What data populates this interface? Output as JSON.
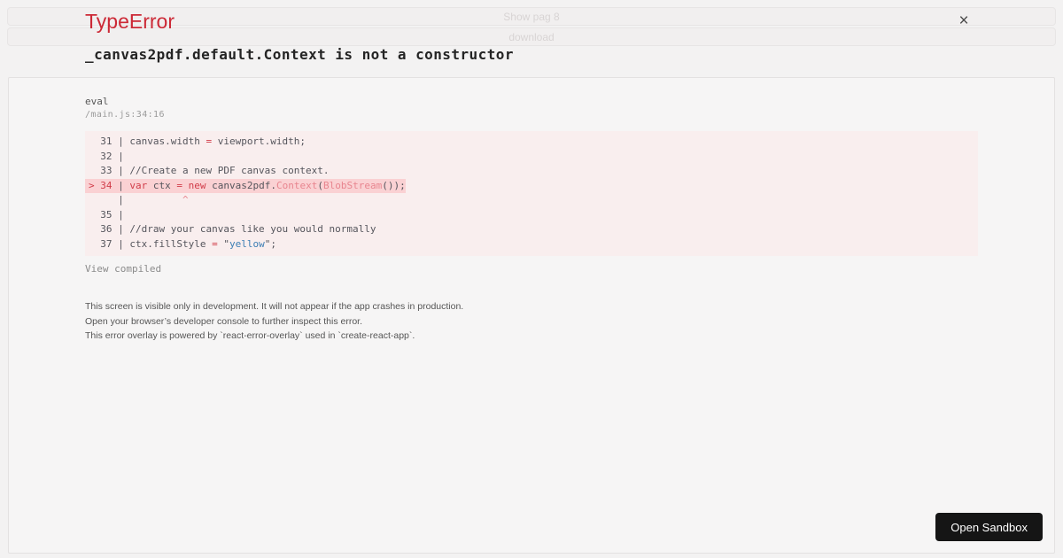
{
  "background_page": {
    "show_page_button": "Show pag 8",
    "download_button": "download"
  },
  "error_overlay": {
    "close_icon": "×",
    "error_type": "TypeError",
    "error_message": "_canvas2pdf.default.Context is not a constructor",
    "stack_frame": {
      "function_name": "eval",
      "source_location": "/main.js:34:16"
    },
    "code_frame": {
      "lines": [
        {
          "highlight": false,
          "tokens": [
            [
              "plain",
              "  31 | canvas.width "
            ],
            [
              "red",
              "="
            ],
            [
              "plain",
              " viewport.width;"
            ]
          ]
        },
        {
          "highlight": false,
          "tokens": [
            [
              "plain",
              "  32 | "
            ]
          ]
        },
        {
          "highlight": false,
          "tokens": [
            [
              "plain",
              "  33 | //Create a new PDF canvas context."
            ]
          ]
        },
        {
          "highlight": true,
          "tokens": [
            [
              "red",
              "> 34 "
            ],
            [
              "plain",
              "| "
            ],
            [
              "red",
              "var"
            ],
            [
              "plain",
              " ctx "
            ],
            [
              "red",
              "="
            ],
            [
              "plain",
              " "
            ],
            [
              "red",
              "new"
            ],
            [
              "plain",
              " canvas2pdf."
            ],
            [
              "salmon",
              "Context"
            ],
            [
              "plain",
              "("
            ],
            [
              "salmon",
              "BlobStream"
            ],
            [
              "plain",
              "());"
            ]
          ]
        },
        {
          "highlight": false,
          "tokens": [
            [
              "plain",
              "     |          "
            ],
            [
              "salmon",
              "^"
            ]
          ]
        },
        {
          "highlight": false,
          "tokens": [
            [
              "plain",
              "  35 | "
            ]
          ]
        },
        {
          "highlight": false,
          "tokens": [
            [
              "plain",
              "  36 | //draw your canvas like you would normally"
            ]
          ]
        },
        {
          "highlight": false,
          "tokens": [
            [
              "plain",
              "  37 | ctx.fillStyle "
            ],
            [
              "red",
              "="
            ],
            [
              "plain",
              " \""
            ],
            [
              "blue",
              "yellow"
            ],
            [
              "plain",
              "\";"
            ]
          ]
        }
      ]
    },
    "view_compiled_link": "View compiled",
    "footer_lines": [
      "This screen is visible only in development. It will not appear if the app crashes in production.",
      "Open your browser’s developer console to further inspect this error.",
      "This error overlay is powered by `react-error-overlay` used in `create-react-app`."
    ]
  },
  "sandbox": {
    "open_button": "Open Sandbox"
  },
  "colors": {
    "error_red": "#cc2936",
    "code_keyword_red": "#d13c49",
    "code_identifier_salmon": "#e8858f",
    "code_string_blue": "#3c7eb4",
    "code_frame_bg": "#f9eeee",
    "highlight_line_bg": "#fad1d3",
    "sandbox_button_bg": "#151515"
  }
}
